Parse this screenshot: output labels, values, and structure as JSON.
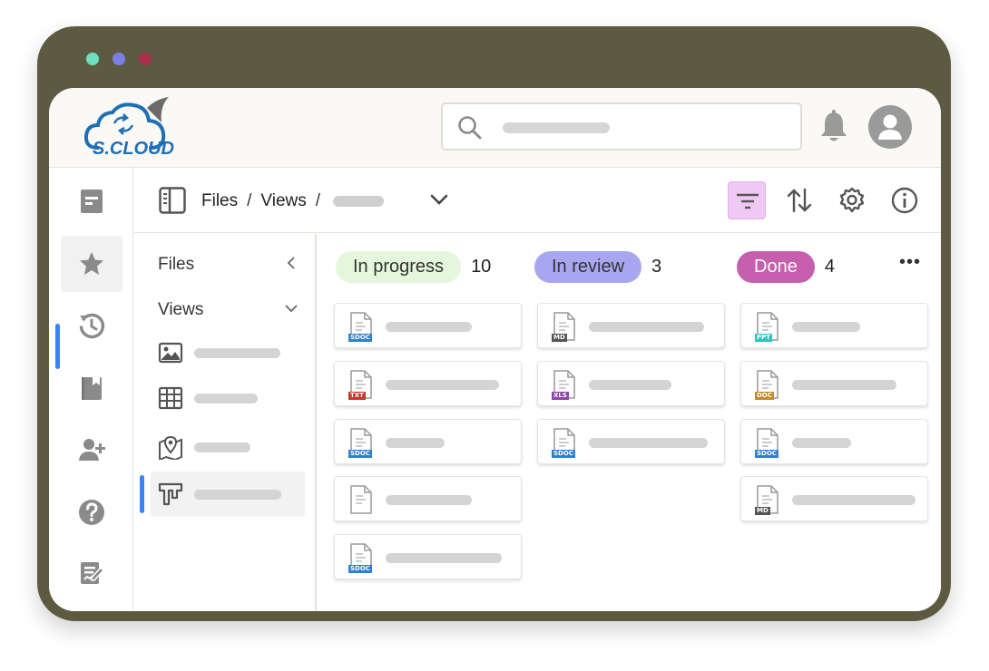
{
  "app": {
    "logo_text": "S.CLOUD",
    "colors": {
      "frame": "#5d5a42",
      "accent": "#3b82f6",
      "filter_active": "#f0c8f4"
    }
  },
  "header": {
    "search_icon": "search-icon",
    "bell_icon": "bell-icon",
    "avatar_icon": "user-avatar-icon"
  },
  "rail": {
    "items": [
      {
        "icon": "document-icon"
      },
      {
        "icon": "star-icon",
        "active": true
      },
      {
        "icon": "history-icon"
      },
      {
        "icon": "bookmark-book-icon"
      },
      {
        "icon": "add-user-icon"
      },
      {
        "icon": "help-icon"
      },
      {
        "icon": "edit-note-icon"
      }
    ]
  },
  "toolbar": {
    "breadcrumb": {
      "part1": "Files",
      "sep1": "/",
      "part2": "Views",
      "sep2": "/"
    },
    "buttons": [
      "filter-icon",
      "sort-icon",
      "settings-icon",
      "info-icon"
    ]
  },
  "views_panel": {
    "files_label": "Files",
    "views_label": "Views",
    "items": [
      {
        "icon": "image-icon"
      },
      {
        "icon": "table-icon"
      },
      {
        "icon": "map-icon"
      },
      {
        "icon": "kanban-icon",
        "active": true
      }
    ]
  },
  "board": {
    "columns": [
      {
        "label": "In progress",
        "count": "10",
        "color": "#e4f7dc",
        "cards": [
          {
            "tag": "SDOC",
            "tag_color": "#2f80d0"
          },
          {
            "tag": "TXT",
            "tag_color": "#c0392b"
          },
          {
            "tag": "SDOC",
            "tag_color": "#2f80d0"
          },
          {
            "tag": "",
            "tag_color": ""
          },
          {
            "tag": "SDOC",
            "tag_color": "#2f80d0"
          }
        ]
      },
      {
        "label": "In review",
        "count": "3",
        "color": "#a9a6f0",
        "cards": [
          {
            "tag": "MD",
            "tag_color": "#555555"
          },
          {
            "tag": "XLS",
            "tag_color": "#8e44ad"
          },
          {
            "tag": "SDOC",
            "tag_color": "#2f80d0"
          }
        ]
      },
      {
        "label": "Done",
        "count": "4",
        "color": "#c65fae",
        "cards": [
          {
            "tag": "PPT",
            "tag_color": "#2ec4c4"
          },
          {
            "tag": "DOC",
            "tag_color": "#c28a2c"
          },
          {
            "tag": "SDOC",
            "tag_color": "#2f80d0"
          },
          {
            "tag": "MD",
            "tag_color": "#555555"
          }
        ]
      }
    ],
    "more_label": "•••"
  }
}
